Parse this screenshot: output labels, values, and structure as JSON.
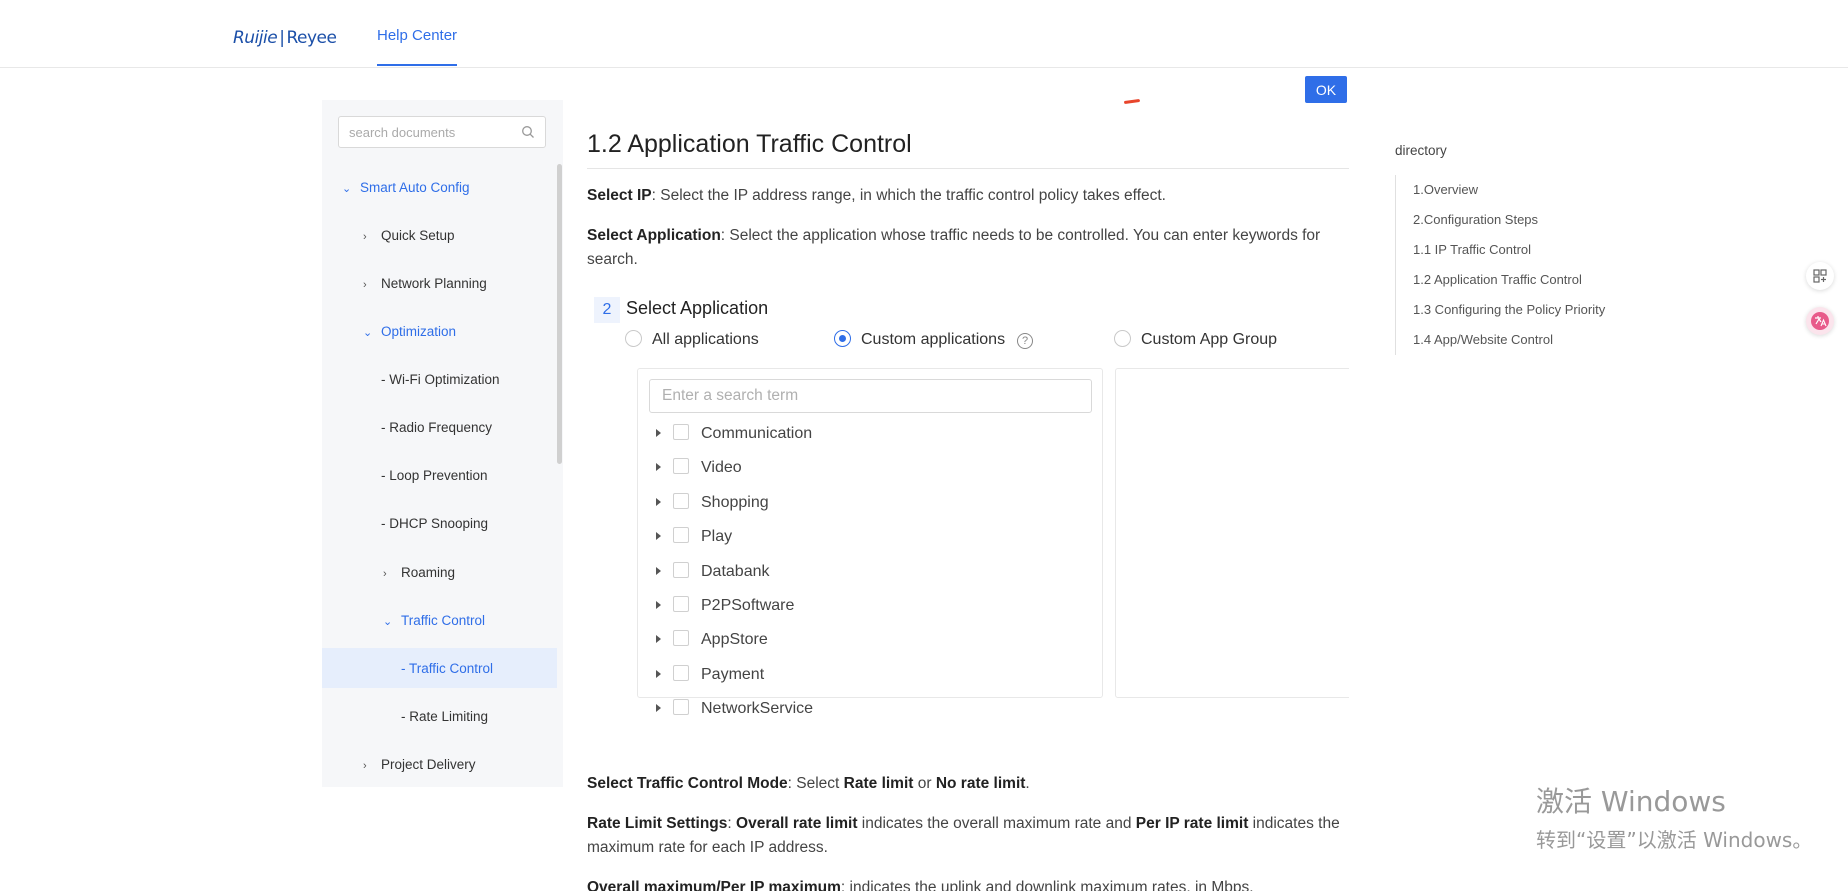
{
  "header": {
    "logo_ruijie": "Ruijie",
    "logo_sep": "|",
    "logo_reyee": "Reyee",
    "nav_help": "Help Center"
  },
  "sidebar": {
    "search_placeholder": "search documents",
    "items": [
      {
        "label": "Smart Auto Config",
        "level": 0,
        "chevron": "down",
        "active": true
      },
      {
        "label": "Quick Setup",
        "level": 1,
        "chevron": "right"
      },
      {
        "label": "Network Planning",
        "level": 1,
        "chevron": "right"
      },
      {
        "label": "Optimization",
        "level": 1,
        "chevron": "down",
        "active": true
      },
      {
        "label": "- Wi-Fi Optimization",
        "level": 2
      },
      {
        "label": "- Radio Frequency",
        "level": 2
      },
      {
        "label": "- Loop Prevention",
        "level": 2
      },
      {
        "label": "- DHCP Snooping",
        "level": 2
      },
      {
        "label": "Roaming",
        "level": 2,
        "chevron": "right"
      },
      {
        "label": "Traffic Control",
        "level": 2,
        "chevron": "down",
        "active": true
      },
      {
        "label": "- Traffic Control",
        "level": 3,
        "active": true,
        "selected": true
      },
      {
        "label": "- Rate Limiting",
        "level": 3
      },
      {
        "label": "Project Delivery",
        "level": 1,
        "chevron": "right"
      }
    ]
  },
  "main": {
    "ok_label": "OK",
    "title": "1.2 Application Traffic Control",
    "p1_bold": "Select IP",
    "p1_text": ": Select the IP address range, in which the traffic control policy takes effect.",
    "p2_bold": "Select Application",
    "p2_text": ": Select the application whose traffic needs to be controlled. You can enter keywords for search.",
    "step_num": "2",
    "step_title": "Select Application",
    "radio_all": "All applications",
    "radio_custom": "Custom applications",
    "radio_group": "Custom App Group",
    "help_glyph": "?",
    "tree_search_placeholder": "Enter a search term",
    "apps": [
      "Communication",
      "Video",
      "Shopping",
      "Play",
      "Databank",
      "P2PSoftware",
      "AppStore",
      "Payment",
      "NetworkService"
    ],
    "p3_bold": "Select Traffic Control Mode",
    "p3_text1": ": Select ",
    "p3_b2": "Rate limit",
    "p3_text2": " or ",
    "p3_b3": "No rate limit",
    "p3_text3": ".",
    "p4_bold": "Rate Limit Settings",
    "p4_text1": ": ",
    "p4_b2": "Overall rate limit",
    "p4_text2": " indicates the overall maximum rate and ",
    "p4_b3": "Per IP rate limit",
    "p4_text3": " indicates the maximum rate for each IP address.",
    "p5_b1": "Overall maximum",
    "p5_sep": "/",
    "p5_b2": "Per IP maximum",
    "p5_text": ": indicates the uplink and downlink maximum rates, in Mbps."
  },
  "directory": {
    "heading": "directory",
    "items": [
      "1.Overview",
      "2.Configuration Steps",
      "1.1 IP Traffic Control",
      "1.2 Application Traffic Control",
      "1.3 Configuring the Policy Priority",
      "1.4 App/Website Control"
    ]
  },
  "watermark": {
    "line1": "激活 Windows",
    "line2": "转到“设置”以激活 Windows。"
  },
  "colors": {
    "accent": "#2f6ee8",
    "selected_bg": "#e6eefc",
    "sidebar_bg": "#f6f7f9"
  }
}
